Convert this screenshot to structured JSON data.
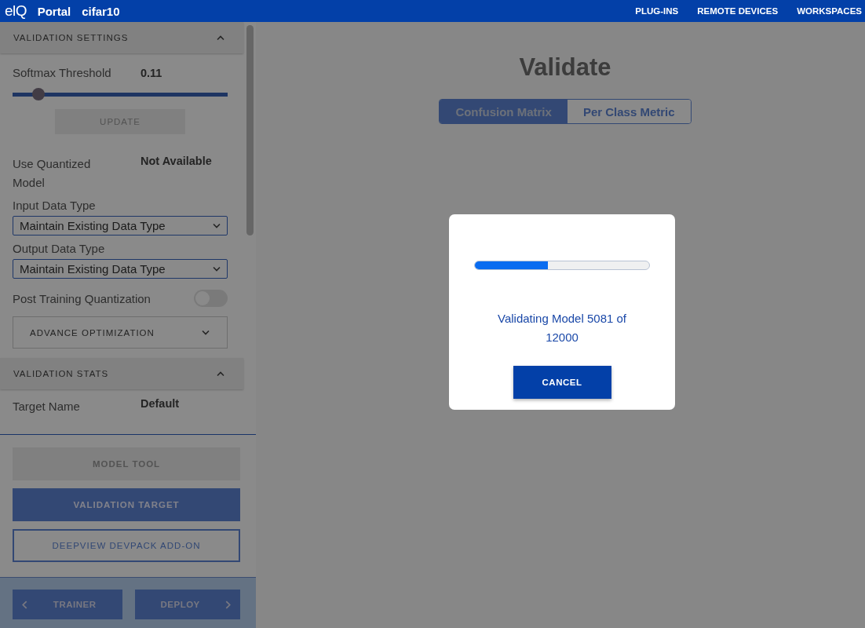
{
  "top_bar": {
    "logo": "eIQ",
    "title": "Portal",
    "project": "cifar10",
    "nav": [
      "PLUG-INS",
      "REMOTE DEVICES",
      "WORKSPACES"
    ]
  },
  "sidebar": {
    "sections": [
      {
        "title": "VALIDATION SETTINGS",
        "expanded": true,
        "items": [
          {
            "kind": "slider",
            "label": "Softmax Threshold",
            "value": "0.11",
            "level": 0.12
          },
          {
            "kind": "button",
            "label": "UPDATE",
            "disabled": true
          },
          {
            "kind": "pair",
            "label": "Use Quantized Model",
            "value": "Not Available"
          },
          {
            "kind": "select",
            "label": "Input Data Type",
            "value": "Maintain Existing Data Type"
          },
          {
            "kind": "select",
            "label": "Output Data Type",
            "value": "Maintain Existing Data Type"
          },
          {
            "kind": "toggle",
            "label": "Post Training Quantization",
            "on": false
          },
          {
            "kind": "expander",
            "label": "ADVANCE OPTIMIZATION",
            "expanded": false
          }
        ]
      },
      {
        "title": "VALIDATION STATS",
        "expanded": true,
        "items": [
          {
            "kind": "pair",
            "label": "Target Name",
            "value": "Default"
          }
        ]
      }
    ],
    "actions": [
      {
        "kind": "disabled",
        "label": "MODEL TOOL"
      },
      {
        "kind": "filled",
        "label": "VALIDATION TARGET"
      },
      {
        "kind": "outline",
        "label": "DEEPVIEW DEVPACK ADD-ON"
      }
    ],
    "nav_buttons": [
      {
        "kind": "back",
        "label": "TRAINER"
      },
      {
        "kind": "next",
        "label": "DEPLOY"
      }
    ]
  },
  "main": {
    "title": "Validate",
    "tabs": [
      {
        "label": "Confusion Matrix",
        "selected": true
      },
      {
        "label": "Per Class Metric",
        "selected": false
      }
    ]
  },
  "dialog": {
    "level": 0.42,
    "message": "Validating Model 5081 of 12000",
    "button": "CANCEL"
  }
}
